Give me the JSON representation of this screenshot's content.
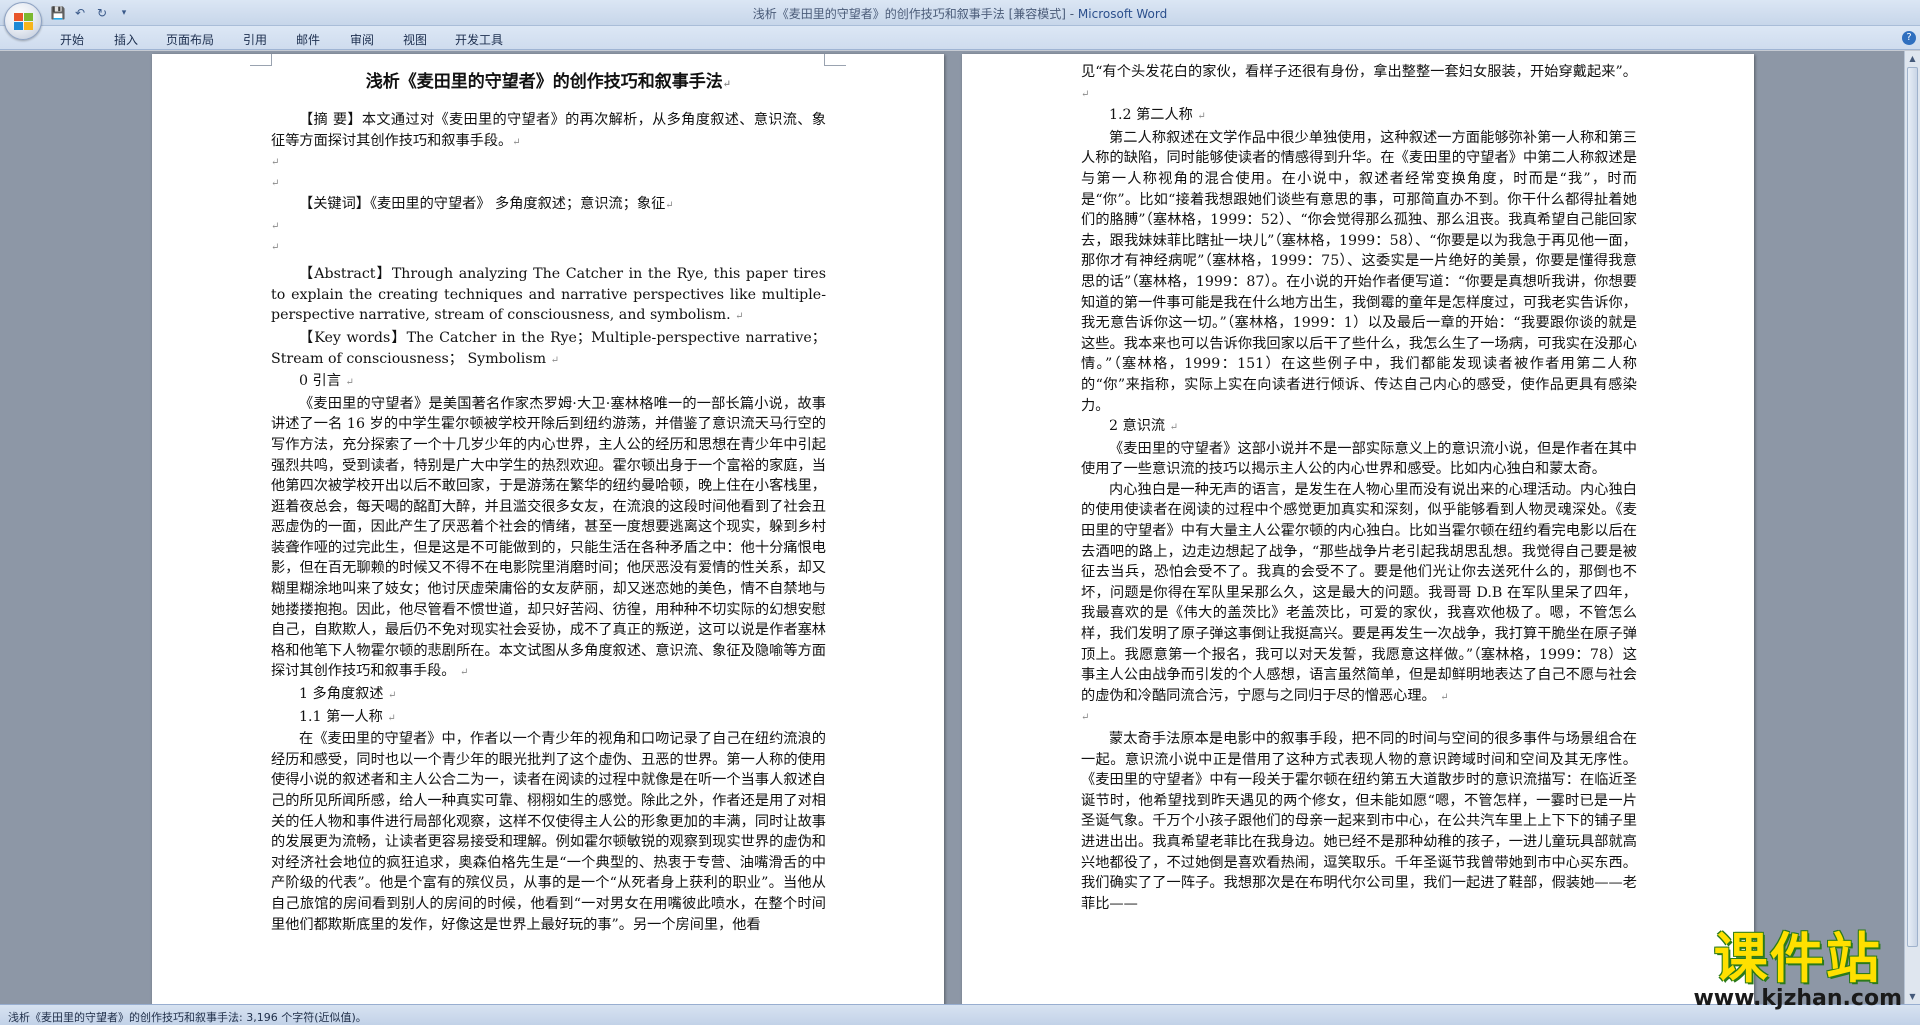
{
  "window": {
    "title_prefix": "浅析《麦田里的守望者》的创作技巧和叙事手法 [兼容模式] - ",
    "title_brand": "Microsoft Word"
  },
  "qat": {
    "save_icon": "save-icon",
    "undo_icon": "undo-icon",
    "redo_icon": "redo-icon",
    "customize_icon": "customize-icon"
  },
  "ribbon_tabs": [
    "开始",
    "插入",
    "页面布局",
    "引用",
    "邮件",
    "审阅",
    "视图",
    "开发工具"
  ],
  "status": {
    "text": "浅析《麦田里的守望者》的创作技巧和叙事手法: 3,196 个字符(近似值)。"
  },
  "watermark": {
    "brand": "课件站",
    "url": "www.kjzhan.com"
  },
  "page1": {
    "title": "浅析《麦田里的守望者》的创作技巧和叙事手法",
    "abstract_cn": "【摘 要】本文通过对《麦田里的守望者》的再次解析，从多角度叙述、意识流、象征等方面探讨其创作技巧和叙事手段。",
    "keywords_cn": "【关键词】《麦田里的守望者》 多角度叙述；意识流；象征",
    "abstract_en": "【Abstract】Through analyzing The Catcher in the Rye,  this paper tires to explain the creating techniques and narrative perspectives like multiple-perspective narrative,  stream of consciousness,  and symbolism.",
    "keywords_en": "【Key words】The Catcher in the Rye；Multiple-perspective narrative；Stream of consciousness；  Symbolism",
    "h0": "0 引言",
    "p0": "《麦田里的守望者》是美国著名作家杰罗姆·大卫·塞林格唯一的一部长篇小说，故事讲述了一名 16 岁的中学生霍尔顿被学校开除后到纽约游荡，并借鉴了意识流天马行空的写作方法，充分探索了一个十几岁少年的内心世界，主人公的经历和思想在青少年中引起强烈共鸣，受到读者，特别是广大中学生的热烈欢迎。霍尔顿出身于一个富裕的家庭，当他第四次被学校开出以后不敢回家，于是游荡在繁华的纽约曼哈顿，晚上住在小客栈里，逛着夜总会，每天喝的酩酊大醉，并且滥交很多女友，在流浪的这段时间他看到了社会丑恶虚伪的一面，因此产生了厌恶着个社会的情绪，甚至一度想要逃离这个现实，躲到乡村装聋作哑的过完此生，但是这是不可能做到的，只能生活在各种矛盾之中：他十分痛恨电影，但在百无聊赖的时候又不得不在电影院里消磨时间；他厌恶没有爱情的性关系，却又糊里糊涂地叫来了妓女；他讨厌虚荣庸俗的女友萨丽，却又迷恋她的美色，情不自禁地与她搂搂抱抱。因此，他尽管看不惯世道，却只好苦闷、彷徨，用种种不切实际的幻想安慰自己，自欺欺人，最后仍不免对现实社会妥协，成不了真正的叛逆，这可以说是作者塞林格和他笔下人物霍尔顿的悲剧所在。本文试图从多角度叙述、意识流、象征及隐喻等方面探讨其创作技巧和叙事手段。",
    "h1": "1 多角度叙述",
    "h11": "1.1 第一人称",
    "p11": "在《麦田里的守望者》中，作者以一个青少年的视角和口吻记录了自己在纽约流浪的经历和感受，同时也以一个青少年的眼光批判了这个虚伪、丑恶的世界。第一人称的使用使得小说的叙述者和主人公合二为一，读者在阅读的过程中就像是在听一个当事人叙述自己的所见所闻所感，给人一种真实可靠、栩栩如生的感觉。除此之外，作者还是用了对相关的任人物和事件进行局部化观察，这样不仅使得主人公的形象更加的丰满，同时让故事的发展更为流畅，让读者更容易接受和理解。例如霍尔顿敏锐的观察到现实世界的虚伪和对经济社会地位的疯狂追求，奥森伯格先生是“一个典型的、热衷于专营、油嘴滑舌的中产阶级的代表”。他是个富有的殡仪员，从事的是一个“从死者身上获利的职业”。当他从自己旅馆的房间看到别人的房间的时候，他看到“一对男女在用嘴彼此喷水，在整个时间里他们都欺斯底里的发作，好像这是世界上最好玩的事”。另一个房间里，他看"
  },
  "page2": {
    "p_top": "见“有个头发花白的家伙，看样子还很有身份，拿出整整一套妇女服装，开始穿戴起来”。",
    "h12": "1.2 第二人称",
    "p12": "第二人称叙述在文学作品中很少单独使用，这种叙述一方面能够弥补第一人称和第三人称的缺陷，同时能够使读者的情感得到升华。在《麦田里的守望者》中第二人称叙述是与第一人称视角的混合使用。在小说中，叙述者经常变换角度，时而是“我”，时而是“你”。比如“接着我想跟她们谈些有意思的事，可那简直办不到。你干什么都得扯着她们的胳膊”（塞林格，1999：52）、“你会觉得那么孤独、那么沮丧。我真希望自己能回家去，跟我妹妹菲比瞎扯一块儿”（塞林格，1999：58）、“你要是以为我急于再见他一面，那你才有神经病呢”（塞林格，1999：75）、这委实是一片绝好的美景，你要是懂得我意思的话”（塞林格，1999：87）。在小说的开始作者便写道：“你要是真想听我讲，你想要知道的第一件事可能是我在什么地方出生，我倒霉的童年是怎样度过，可我老实告诉你，我无意告诉你这一切。”（塞林格，1999：1）以及最后一章的开始：“我要跟你谈的就是这些。我本来也可以告诉你我回家以后干了些什么，我怎么生了一场病，可我实在没那心情。”（塞林格，1999：151）在这些例子中，我们都能发现读者被作者用第二人称的“你”来指称，实际上实在向读者进行倾诉、传达自己内心的感受，使作品更具有感染力。",
    "h2": "2 意识流",
    "p2a": "《麦田里的守望者》这部小说并不是一部实际意义上的意识流小说，但是作者在其中使用了一些意识流的技巧以揭示主人公的内心世界和感受。比如内心独白和蒙太奇。",
    "p2b": "内心独白是一种无声的语言，是发生在人物心里而没有说出来的心理活动。内心独白的使用使读者在阅读的过程中个感觉更加真实和深刻，似乎能够看到人物灵魂深处。《麦田里的守望者》中有大量主人公霍尔顿的内心独白。比如当霍尔顿在纽约看完电影以后在去酒吧的路上，边走边想起了战争，“那些战争片老引起我胡思乱想。我觉得自己要是被征去当兵，恐怕会受不了。我真的会受不了。要是他们光让你去送死什么的，那倒也不坏，问题是你得在军队里呆那么久，这是最大的问题。我哥哥 D.B 在军队里呆了四年，我最喜欢的是《伟大的盖茨比》老盖茨比，可爱的家伙，我喜欢他极了。嗯，不管怎么样，我们发明了原子弹这事倒让我挺高兴。要是再发生一次战争，我打算干脆坐在原子弹顶上。我愿意第一个报名，我可以对天发誓，我愿意这样做。”（塞林格，1999：78）这事主人公由战争而引发的个人感想，语言虽然简单，但是却鲜明地表达了自己不愿与社会的虚伪和冷酷同流合污，宁愿与之同归于尽的憎恶心理。",
    "p2c": "蒙太奇手法原本是电影中的叙事手段，把不同的时间与空间的很多事件与场景组合在一起。意识流小说中正是借用了这种方式表现人物的意识跨域时间和空间及其无序性。《麦田里的守望者》中有一段关于霍尔顿在纽约第五大道散步时的意识流描写：在临近圣诞节时，他希望找到昨天遇见的两个修女，但未能如愿“嗯，不管怎样，一霎时已是一片圣诞气象。千万个小孩子跟他们的母亲一起来到市中心，在公共汽车里上上下下的铺子里进进出出。我真希望老菲比在我身边。她已经不是那种幼稚的孩子，一进儿童玩具部就高兴地都役了，不过她倒是喜欢看热闹，逗笑取乐。千年圣诞节我曾带她到市中心买东西。我们确实了了一阵子。我想那次是在布明代尔公司里，我们一起进了鞋部，假装她——老菲比——"
  }
}
